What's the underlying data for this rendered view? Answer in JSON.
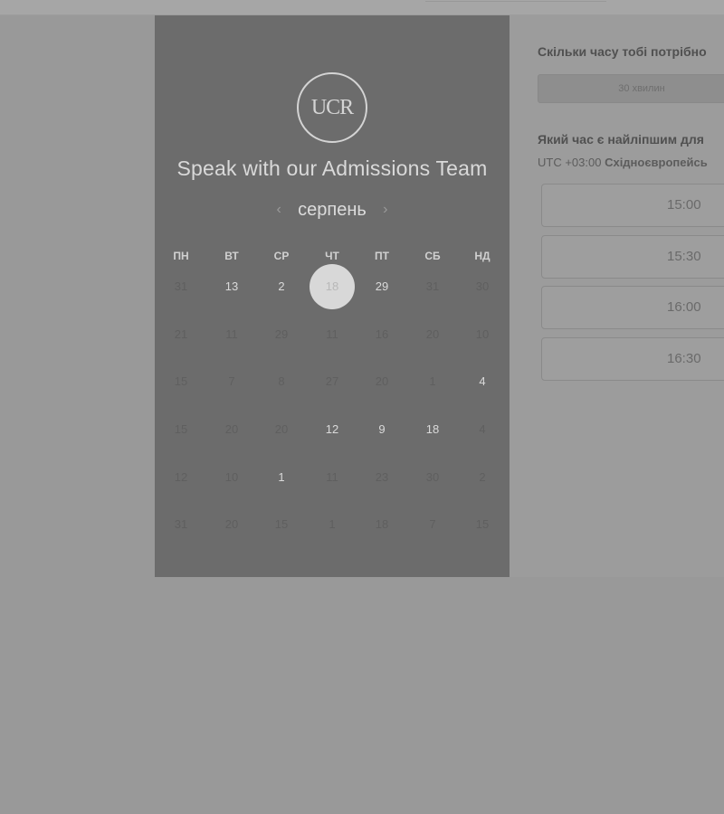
{
  "calendar": {
    "logo_text": "UCR",
    "title": "Speak with our Admissions Team",
    "month": "серпень",
    "prev_icon": "chevron-left-icon",
    "next_icon": "chevron-right-icon",
    "weekdays": [
      "ПН",
      "ВТ",
      "СР",
      "ЧТ",
      "ПТ",
      "СБ",
      "НД"
    ],
    "weeks": [
      [
        {
          "d": "31",
          "a": false
        },
        {
          "d": "13",
          "a": true
        },
        {
          "d": "2",
          "a": true
        },
        {
          "d": "18",
          "a": true,
          "sel": true
        },
        {
          "d": "29",
          "a": true
        },
        {
          "d": "31",
          "a": false
        },
        {
          "d": "30",
          "a": false
        }
      ],
      [
        {
          "d": "21",
          "a": false
        },
        {
          "d": "11",
          "a": false
        },
        {
          "d": "29",
          "a": false
        },
        {
          "d": "11",
          "a": false
        },
        {
          "d": "16",
          "a": false
        },
        {
          "d": "20",
          "a": false
        },
        {
          "d": "10",
          "a": false
        }
      ],
      [
        {
          "d": "15",
          "a": false
        },
        {
          "d": "7",
          "a": false
        },
        {
          "d": "8",
          "a": false
        },
        {
          "d": "27",
          "a": false
        },
        {
          "d": "20",
          "a": false
        },
        {
          "d": "1",
          "a": false
        },
        {
          "d": "4",
          "a": true
        }
      ],
      [
        {
          "d": "15",
          "a": false
        },
        {
          "d": "20",
          "a": false
        },
        {
          "d": "20",
          "a": false
        },
        {
          "d": "12",
          "a": true
        },
        {
          "d": "9",
          "a": true
        },
        {
          "d": "18",
          "a": true
        },
        {
          "d": "4",
          "a": false
        }
      ],
      [
        {
          "d": "12",
          "a": false
        },
        {
          "d": "10",
          "a": false
        },
        {
          "d": "1",
          "a": true
        },
        {
          "d": "11",
          "a": false
        },
        {
          "d": "23",
          "a": false
        },
        {
          "d": "30",
          "a": false
        },
        {
          "d": "2",
          "a": false
        }
      ],
      [
        {
          "d": "31",
          "a": false
        },
        {
          "d": "20",
          "a": false
        },
        {
          "d": "15",
          "a": false
        },
        {
          "d": "1",
          "a": false
        },
        {
          "d": "18",
          "a": false
        },
        {
          "d": "7",
          "a": false
        },
        {
          "d": "15",
          "a": false
        }
      ]
    ]
  },
  "booking": {
    "duration_question": "Скільки часу тобі потрібно",
    "duration_value": "30 хвилин",
    "time_question": "Який час є найліпшим для",
    "tz_prefix": "UTC +03:00",
    "tz_name": "Східноєвропейсь",
    "slots": [
      "15:00",
      "15:30",
      "16:00",
      "16:30"
    ]
  }
}
